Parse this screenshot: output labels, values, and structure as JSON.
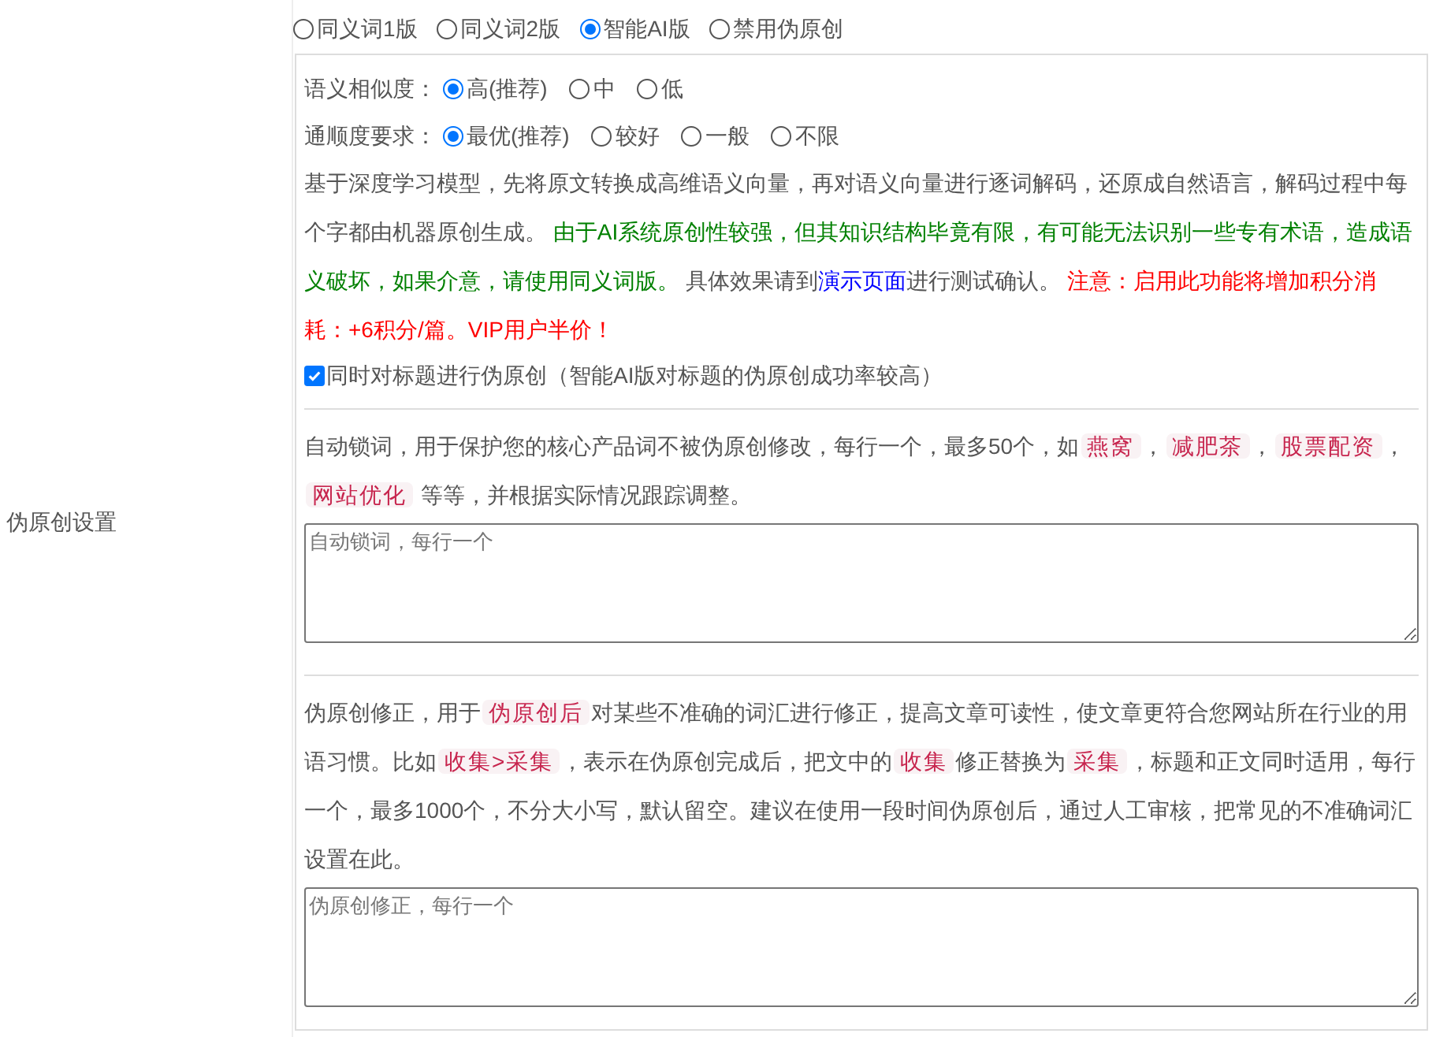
{
  "side_label": "伪原创设置",
  "modes": [
    {
      "label": "同义词1版",
      "selected": false
    },
    {
      "label": "同义词2版",
      "selected": false
    },
    {
      "label": "智能AI版",
      "selected": true
    },
    {
      "label": "禁用伪原创",
      "selected": false
    }
  ],
  "options": [
    {
      "label": "语义相似度：",
      "choices": [
        {
          "label": "高(推荐)",
          "selected": true
        },
        {
          "label": "中",
          "selected": false
        },
        {
          "label": "低",
          "selected": false
        }
      ]
    },
    {
      "label": "通顺度要求：",
      "choices": [
        {
          "label": "最优(推荐)",
          "selected": true
        },
        {
          "label": "较好",
          "selected": false
        },
        {
          "label": "一般",
          "selected": false
        },
        {
          "label": "不限",
          "selected": false
        }
      ]
    }
  ],
  "ai_description": [
    {
      "kind": "plain",
      "text": "基于深度学习模型，先将原文转换成高维语义向量，再对语义向量进行逐词解码，还原成自然语言，解码过程中每个字都由机器原创生成。 "
    },
    {
      "kind": "green",
      "text": "由于AI系统原创性较强，但其知识结构毕竟有限，有可能无法识别一些专有术语，造成语义破坏，如果介意，请使用同义词版。"
    },
    {
      "kind": "plain",
      "text": " 具体效果请到"
    },
    {
      "kind": "link",
      "text": "演示页面"
    },
    {
      "kind": "plain",
      "text": "进行测试确认。 "
    },
    {
      "kind": "red",
      "text": "注意：启用此功能将增加积分消耗：+6积分/篇。VIP用户半价！"
    }
  ],
  "title_option": {
    "label": "同时对标题进行伪原创（智能AI版对标题的伪原创成功率较高）",
    "checked": true
  },
  "lock_description": [
    {
      "kind": "plain",
      "text": "自动锁词，用于保护您的核心产品词不被伪原创修改，每行一个，最多50个，如"
    },
    {
      "kind": "tag",
      "text": "燕窝"
    },
    {
      "kind": "plain",
      "text": "，"
    },
    {
      "kind": "tag",
      "text": "减肥茶"
    },
    {
      "kind": "plain",
      "text": "，"
    },
    {
      "kind": "tag",
      "text": "股票配资"
    },
    {
      "kind": "plain",
      "text": "，"
    },
    {
      "kind": "tag",
      "text": "网站优化"
    },
    {
      "kind": "plain",
      "text": " 等等，并根据实际情况跟踪调整。"
    }
  ],
  "lock_field": {
    "placeholder": "自动锁词，每行一个"
  },
  "fix_description": [
    {
      "kind": "plain",
      "text": "伪原创修正，用于"
    },
    {
      "kind": "tag",
      "text": "伪原创后"
    },
    {
      "kind": "plain",
      "text": "对某些不准确的词汇进行修正，提高文章可读性，使文章更符合您网站所在行业的用语习惯。比如"
    },
    {
      "kind": "tag",
      "text": "收集>采集"
    },
    {
      "kind": "plain",
      "text": "，表示在伪原创完成后，把文中的"
    },
    {
      "kind": "tag",
      "text": "收集"
    },
    {
      "kind": "plain",
      "text": "修正替换为"
    },
    {
      "kind": "tag",
      "text": "采集"
    },
    {
      "kind": "plain",
      "text": "，标题和正文同时适用，每行一个，最多1000个，不分大小写，默认留空。建议在使用一段时间伪原创后，通过人工审核，把常见的不准确词汇设置在此。"
    }
  ],
  "fix_field": {
    "placeholder": "伪原创修正，每行一个"
  }
}
